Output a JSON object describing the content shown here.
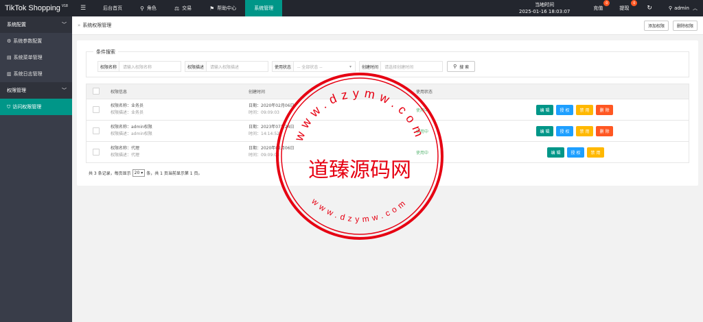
{
  "app": {
    "logo": "TikTok Shopping",
    "version": "V18"
  },
  "topnav": {
    "items": [
      {
        "label": "后台首页"
      },
      {
        "label": "角色",
        "icon": "user-icon"
      },
      {
        "label": "交易",
        "icon": "scale-icon"
      },
      {
        "label": "帮助中心",
        "icon": "flag-icon"
      },
      {
        "label": "系统管理"
      }
    ]
  },
  "topright": {
    "clock_label": "当地时间",
    "clock_value": "2025-01-16 18:03:07",
    "recharge": "充值",
    "recharge_badge": "0",
    "withdraw": "提现",
    "withdraw_badge": "0",
    "user": "admin"
  },
  "sidebar": {
    "group1": "系统配置",
    "items1": [
      {
        "label": "系统参数配置"
      },
      {
        "label": "系统菜单管理"
      },
      {
        "label": "系统日志管理"
      }
    ],
    "group2": "权限管理",
    "items2": [
      {
        "label": "访问权限管理"
      }
    ]
  },
  "breadcrumb": {
    "sep": "»",
    "title": "系统权限管理",
    "add": "添加权限",
    "delete": "删除权限"
  },
  "search": {
    "legend": "条件搜索",
    "name_label": "权限名称",
    "name_placeholder": "请输入权限名称",
    "desc_label": "权限描述",
    "desc_placeholder": "请输入权限描述",
    "status_label": "使用状态",
    "status_value": "-- 全部状态 --",
    "time_label": "创建时间",
    "time_placeholder": "请选择创建时间",
    "button": "搜 索"
  },
  "table": {
    "headers": {
      "info": "权限信息",
      "time": "创建时间",
      "status": "使用状态"
    },
    "rows": [
      {
        "name": "权限名称：业务员",
        "desc": "权限描述：业务员",
        "date": "日期：2020年02月06日",
        "time": "时间：09:09:03",
        "status": "使用中",
        "actions": [
          "编 辑",
          "授 权",
          "禁 用",
          "删 除"
        ]
      },
      {
        "name": "权限名称：admin权限",
        "desc": "权限描述：admin权限",
        "date": "日期：2023年07月24日",
        "time": "时间：14:14:52",
        "status": "使用中",
        "actions": [
          "编 辑",
          "授 权",
          "禁 用",
          "删 除"
        ]
      },
      {
        "name": "权限名称：代理",
        "desc": "权限描述：代理",
        "date": "日期：2020年02月06日",
        "time": "时间：09:09:03",
        "status": "使用中",
        "actions": [
          "编 辑",
          "授 权",
          "禁 用"
        ]
      }
    ]
  },
  "pager": {
    "prefix": "共 3 条记录，每页显示",
    "per_page": "20",
    "suffix": "条，共 1 页当前显示第 1 页。"
  },
  "watermark": {
    "top_text": "www.dzymw.com",
    "center_text": "道臻源码网",
    "bottom_text": "www.dzymw.com",
    "color": "#e60012"
  }
}
